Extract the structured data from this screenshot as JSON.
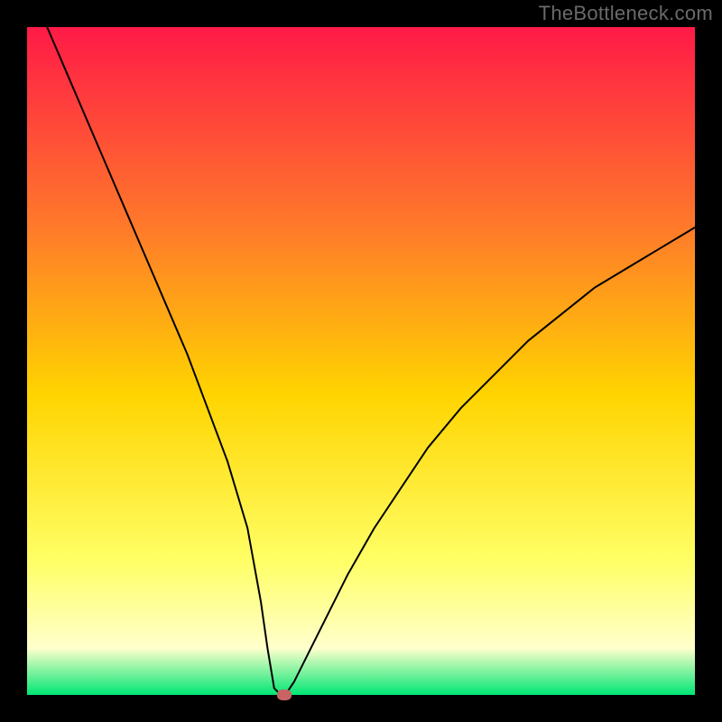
{
  "watermark": "TheBottleneck.com",
  "colors": {
    "frame_bg": "#000000",
    "watermark": "#6a6a6a",
    "curve": "#000000",
    "marker": "#c86464",
    "gradient_top": "#ff1a47",
    "gradient_upper_mid": "#ff7a2a",
    "gradient_mid": "#ffd400",
    "gradient_lower_mid": "#ffff66",
    "gradient_cream": "#ffffcc",
    "gradient_bottom": "#00e673"
  },
  "chart_data": {
    "type": "line",
    "title": "",
    "xlabel": "",
    "ylabel": "",
    "xlim": [
      0,
      100
    ],
    "ylim": [
      0,
      100
    ],
    "grid": false,
    "legend": false,
    "description": "Bottleneck curve: y is the mismatch percentage. It drops to zero at the optimum around x≈38 then rises again. Background is a vertical gradient from red (high mismatch) through orange/yellow to green (no mismatch).",
    "optimum_x": 38,
    "series": [
      {
        "name": "bottleneck-curve",
        "x": [
          3,
          6,
          9,
          12,
          15,
          18,
          21,
          24,
          27,
          30,
          33,
          35,
          36,
          37,
          38,
          39,
          40,
          42,
          45,
          48,
          52,
          56,
          60,
          65,
          70,
          75,
          80,
          85,
          90,
          95,
          100
        ],
        "y": [
          100,
          93,
          86,
          79,
          72,
          65,
          58,
          51,
          43,
          35,
          25,
          14,
          7,
          1,
          0,
          0.5,
          2,
          6,
          12,
          18,
          25,
          31,
          37,
          43,
          48,
          53,
          57,
          61,
          64,
          67,
          70
        ]
      }
    ],
    "marker": {
      "x": 38.5,
      "y": 0
    }
  }
}
